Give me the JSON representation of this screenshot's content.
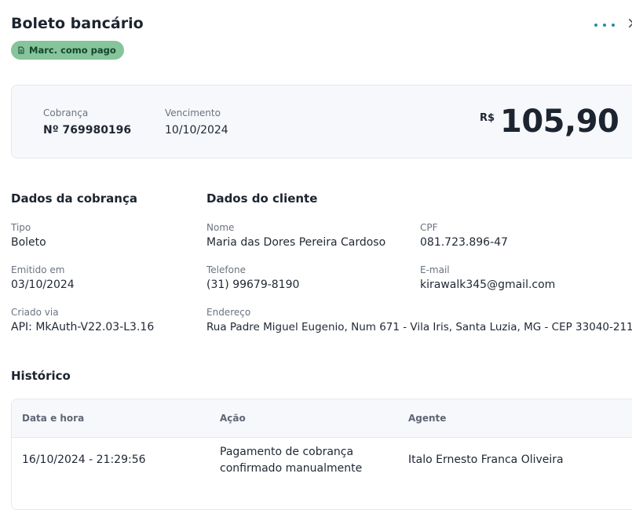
{
  "header": {
    "title": "Boleto bancário",
    "badge_label": "Marc. como pago",
    "more_icon": "more-dots-icon",
    "close_icon": "close-icon"
  },
  "summary": {
    "cobranca_label": "Cobrança",
    "cobranca_value": "Nº 769980196",
    "vencimento_label": "Vencimento",
    "vencimento_value": "10/10/2024",
    "currency": "R$",
    "amount": "105,90"
  },
  "dados_cobranca": {
    "title": "Dados da cobrança",
    "tipo_label": "Tipo",
    "tipo_value": "Boleto",
    "emitido_label": "Emitido em",
    "emitido_value": "03/10/2024",
    "criado_label": "Criado via",
    "criado_value": "API: MkAuth-V22.03-L3.16"
  },
  "dados_cliente": {
    "title": "Dados do cliente",
    "nome_label": "Nome",
    "nome_value": "Maria das Dores Pereira Cardoso",
    "cpf_label": "CPF",
    "cpf_value": "081.723.896-47",
    "telefone_label": "Telefone",
    "telefone_value": "(31) 99679-8190",
    "email_label": "E-mail",
    "email_value": "kirawalk345@gmail.com",
    "endereco_label": "Endereço",
    "endereco_value": "Rua Padre Miguel Eugenio, Num 671 - Vila Iris, Santa Luzia, MG - CEP 33040-211"
  },
  "historico": {
    "title": "Histórico",
    "columns": [
      "Data e hora",
      "Ação",
      "Agente"
    ],
    "rows": [
      {
        "datetime": "16/10/2024 - 21:29:56",
        "acao_line1": "Pagamento de cobrança",
        "acao_line2": "confirmado manualmente",
        "agente": "Italo Ernesto Franca Oliveira"
      }
    ]
  },
  "colors": {
    "accent": "#1e8fa3",
    "badge_bg": "#86c49b",
    "panel_bg": "#f6f8fb"
  }
}
